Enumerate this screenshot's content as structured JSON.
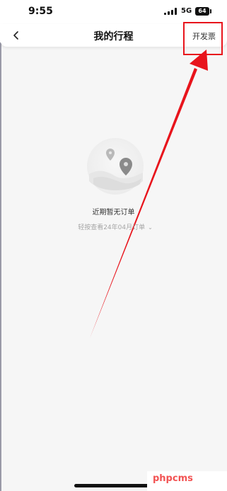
{
  "status_bar": {
    "time": "9:55",
    "network": "5G",
    "battery": "64"
  },
  "nav": {
    "title": "我的行程",
    "action_label": "开发票"
  },
  "empty_state": {
    "title": "近期暂无订单",
    "history_link": "轻按查看24年04月订单"
  },
  "watermark": {
    "text": "phpcms"
  },
  "colors": {
    "annotation": "#e8141c",
    "background": "#f6f6f6",
    "muted_text": "#a6a6a6"
  },
  "icons": {
    "back": "chevron-left-icon",
    "map_pin": "map-pin-icon",
    "expand": "chevron-down-icon"
  }
}
